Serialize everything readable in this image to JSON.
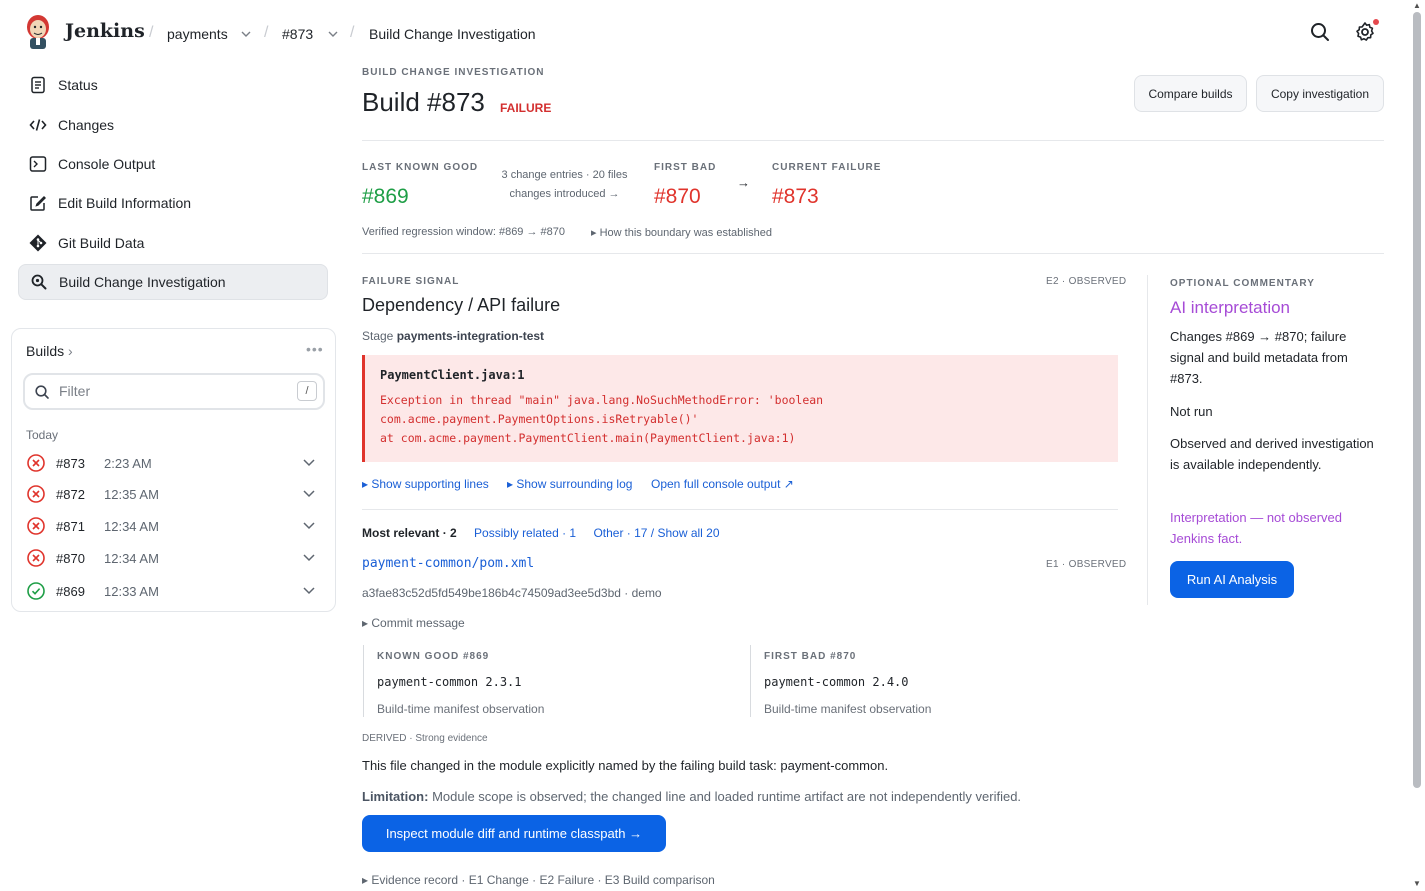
{
  "header": {
    "brand": "Jenkins",
    "breadcrumbs": [
      {
        "label": "payments",
        "has_dropdown": true
      },
      {
        "label": "#873",
        "has_dropdown": true
      },
      {
        "label": "Build Change Investigation",
        "has_dropdown": false
      }
    ],
    "icons": [
      "search-icon",
      "settings-gear-icon"
    ],
    "notification_color": "#e5484d"
  },
  "sidebar": {
    "items": [
      {
        "label": "Status",
        "icon": "document-icon",
        "active": false
      },
      {
        "label": "Changes",
        "icon": "code-icon",
        "active": false
      },
      {
        "label": "Console Output",
        "icon": "terminal-icon",
        "active": false
      },
      {
        "label": "Edit Build Information",
        "icon": "edit-icon",
        "active": false
      },
      {
        "label": "Git Build Data",
        "icon": "git-icon",
        "active": false
      },
      {
        "label": "Build Change Investigation",
        "icon": "search-magnify-icon",
        "active": true
      }
    ]
  },
  "builds": {
    "title": "Builds",
    "filter_placeholder": "Filter",
    "filter_shortcut": "/",
    "group_label": "Today",
    "rows": [
      {
        "number": "#873",
        "time": "2:23 AM",
        "status": "failure"
      },
      {
        "number": "#872",
        "time": "12:35 AM",
        "status": "failure"
      },
      {
        "number": "#871",
        "time": "12:34 AM",
        "status": "failure"
      },
      {
        "number": "#870",
        "time": "12:34 AM",
        "status": "failure"
      },
      {
        "number": "#869",
        "time": "12:33 AM",
        "status": "success"
      }
    ]
  },
  "main": {
    "kicker": "BUILD CHANGE INVESTIGATION",
    "title": "Build #873",
    "status_badge": "FAILURE",
    "buttons": {
      "compare": "Compare builds",
      "copy": "Copy investigation"
    },
    "boundary": {
      "last_good_label": "LAST KNOWN GOOD",
      "last_good": "#869",
      "changes_note_1": "3 change entries · 20 files",
      "changes_note_2": "changes introduced →",
      "first_bad_label": "FIRST BAD",
      "first_bad": "#870",
      "arrow": "→",
      "current_label": "CURRENT FAILURE",
      "current": "#873",
      "window_text": "Verified regression window: #869 → #870",
      "how_link": "▸ How this boundary was established"
    },
    "failure": {
      "kicker": "FAILURE SIGNAL",
      "tag": "E2 · OBSERVED",
      "title": "Dependency / API failure",
      "stage_prefix": "Stage",
      "stage_name": "payments-integration-test",
      "file": "PaymentClient.java:1",
      "lines": [
        "Exception in thread \"main\" java.lang.NoSuchMethodError: 'boolean",
        "com.acme.payment.PaymentOptions.isRetryable()'",
        "at com.acme.payment.PaymentClient.main(PaymentClient.java:1)"
      ],
      "links": {
        "supporting": "▸ Show supporting lines",
        "surrounding": "▸ Show surrounding log",
        "console": "Open full console output ↗"
      }
    },
    "changes": {
      "tab_active": "Most relevant · 2",
      "tab_possibly": "Possibly related · 1",
      "tab_other": "Other · 17 / Show all 20",
      "file": "payment-common/pom.xml",
      "file_tag": "E1 · OBSERVED",
      "hash_line": "a3fae83c52d5fd549be186b4c74509ad3ee5d3bd · demo",
      "commit_toggle": "▸ Commit message",
      "known_good": {
        "label": "KNOWN GOOD #869",
        "value": "payment-common 2.3.1",
        "note": "Build-time manifest observation"
      },
      "first_bad": {
        "label": "FIRST BAD #870",
        "value": "payment-common 2.4.0",
        "note": "Build-time manifest observation"
      },
      "derived": "DERIVED · Strong evidence",
      "statement": "This file changed in the module explicitly named by the failing build task: payment-common.",
      "limitation_label": "Limitation:",
      "limitation_text": "Module scope is observed; the changed line and loaded runtime artifact are not independently verified.",
      "inspect_button": "Inspect module diff and runtime classpath →",
      "evidence": "▸ Evidence record · E1 Change · E2 Failure · E3 Build comparison"
    }
  },
  "commentary": {
    "kicker": "OPTIONAL COMMENTARY",
    "title": "AI interpretation",
    "text1": "Changes #869 → #870; failure signal and build metadata from #873.",
    "text2": "Not run",
    "text3": "Observed and derived investigation is available independently.",
    "note": "Interpretation — not observed Jenkins fact.",
    "button": "Run AI Analysis"
  },
  "colors": {
    "accent": "#0b63e5",
    "good": "#1e9e46",
    "bad": "#e0342c",
    "ai": "#a64bd6",
    "error_bg": "#fde8e8"
  }
}
